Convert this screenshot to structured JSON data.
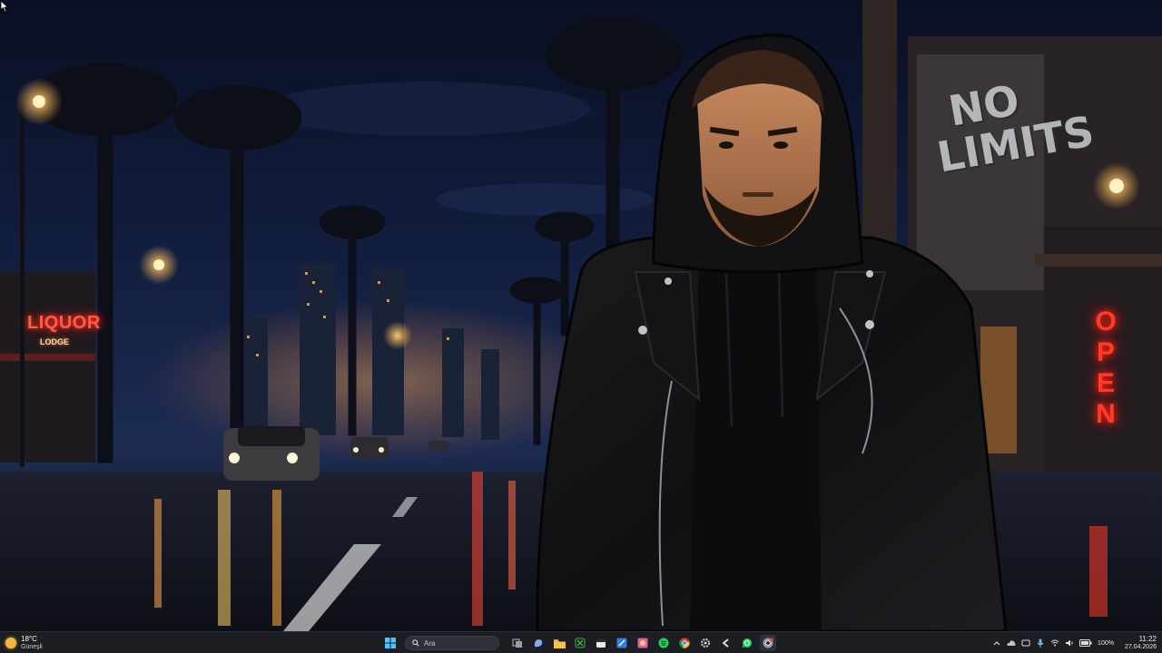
{
  "wallpaper": {
    "signs": {
      "liquor": "LIQUOR",
      "liquor_sub": "LODGE",
      "open": [
        "O",
        "P",
        "E",
        "N"
      ],
      "graffiti": [
        "NO",
        "LIMITS"
      ]
    }
  },
  "taskbar": {
    "weather": {
      "temp": "18°C",
      "condition": "Güneşli"
    },
    "search": {
      "placeholder": "Ara"
    },
    "apps": [
      {
        "name": "task-view",
        "color": "#9aa0a8"
      },
      {
        "name": "copilot",
        "color": "#5fb8ff"
      },
      {
        "name": "file-explorer",
        "color": "#f3c34b"
      },
      {
        "name": "xbox",
        "color": "#3fb33f"
      },
      {
        "name": "calendar",
        "color": "#e9e9e9"
      },
      {
        "name": "editor",
        "color": "#2f7de1"
      },
      {
        "name": "photos",
        "color": "#e25fa6"
      },
      {
        "name": "spotify",
        "color": "#1ed760"
      },
      {
        "name": "chrome",
        "color": "#f2c230"
      },
      {
        "name": "settings",
        "color": "#cfd2d6"
      },
      {
        "name": "capcut",
        "color": "#e6e6e6"
      },
      {
        "name": "whatsapp",
        "color": "#25d366"
      },
      {
        "name": "chrome-profile",
        "color": "#e04545"
      }
    ],
    "tray": {
      "battery": "100%",
      "time": "11:22",
      "date": "27.04.2026"
    }
  }
}
